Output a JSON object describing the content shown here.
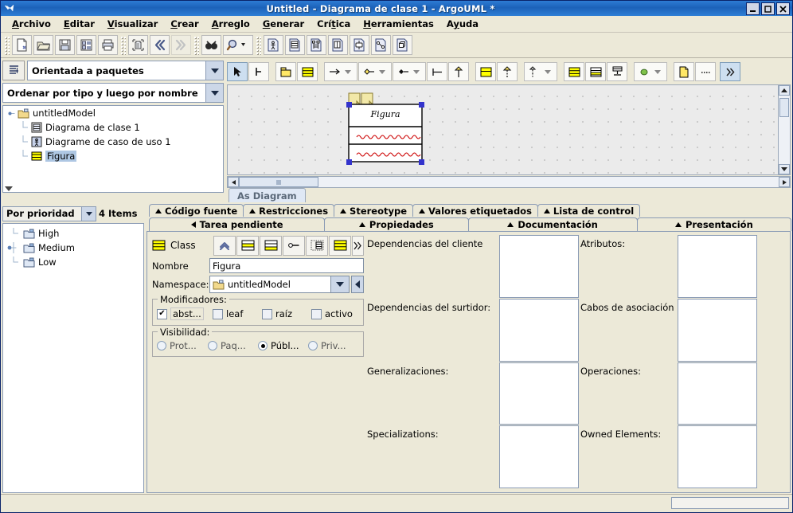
{
  "window": {
    "title": "Untitled - Diagrama de clase 1 - ArgoUML *",
    "app_icon": "argouml-icon",
    "buttons": {
      "minimize": "_",
      "maximize": "□",
      "close": "✕"
    }
  },
  "menubar": {
    "items": [
      {
        "label": "Archivo",
        "mnemonic": "A"
      },
      {
        "label": "Editar",
        "mnemonic": "E"
      },
      {
        "label": "Visualizar",
        "mnemonic": "V"
      },
      {
        "label": "Crear",
        "mnemonic": "C"
      },
      {
        "label": "Arreglo",
        "mnemonic": "A"
      },
      {
        "label": "Generar",
        "mnemonic": "G"
      },
      {
        "label": "Crítica",
        "mnemonic": "t"
      },
      {
        "label": "Herramientas",
        "mnemonic": "H"
      },
      {
        "label": "Ayuda",
        "mnemonic": "y"
      }
    ]
  },
  "main_toolbar": {
    "groups": [
      {
        "buttons": [
          {
            "name": "new-icon",
            "title": "Nuevo"
          },
          {
            "name": "open-icon",
            "title": "Abrir proyecto"
          },
          {
            "name": "save-icon",
            "title": "Guardar proyecto"
          },
          {
            "name": "properties-icon",
            "title": "Propiedades"
          },
          {
            "name": "print-icon",
            "title": "Imprimir"
          }
        ]
      },
      {
        "buttons": [
          {
            "name": "delete-icon",
            "title": "Borrar"
          },
          {
            "name": "navigate-back-icon",
            "title": "Atrás"
          },
          {
            "name": "navigate-forward-icon",
            "title": "Adelante",
            "disabled": true
          }
        ]
      },
      {
        "buttons": [
          {
            "name": "find-icon",
            "title": "Buscar"
          },
          {
            "name": "zoom-icon",
            "title": "Zoom",
            "has_dropdown": true
          }
        ]
      },
      {
        "buttons": [
          {
            "name": "new-usecase-diagram-icon",
            "title": "Nuevo diagrama de caso de uso"
          },
          {
            "name": "new-class-diagram-icon",
            "title": "Nuevo diagrama de clase"
          },
          {
            "name": "new-sequence-diagram-icon",
            "title": "Nuevo diagrama de secuencia"
          },
          {
            "name": "new-collaboration-diagram-icon",
            "title": "Nuevo diagrama de colaboración"
          },
          {
            "name": "new-state-diagram-icon",
            "title": "Nuevo diagrama de estado"
          },
          {
            "name": "new-activity-diagram-icon",
            "title": "Nuevo diagrama de actividad"
          },
          {
            "name": "new-deployment-diagram-icon",
            "title": "Nuevo diagrama de despliegue"
          }
        ]
      }
    ]
  },
  "explorer": {
    "perspective_button_icon": "perspective-icon",
    "perspective_combo": "Orientada a paquetes",
    "order_combo": "Ordenar por tipo y luego por nombre",
    "tree": [
      {
        "label": "untitledModel",
        "icon": "package-icon",
        "depth": 0,
        "expanded": true,
        "selected": false
      },
      {
        "label": "Diagrama de clase 1",
        "icon": "class-diagram-icon",
        "depth": 1,
        "selected": false
      },
      {
        "label": "Diagrame de caso de uso 1",
        "icon": "usecase-diagram-icon",
        "depth": 1,
        "selected": false
      },
      {
        "label": "Figura",
        "icon": "class-icon",
        "depth": 1,
        "selected": true
      }
    ]
  },
  "diagram": {
    "toolbar": [
      {
        "name": "select-tool-icon",
        "selected": true
      },
      {
        "name": "broom-tool-icon"
      },
      {
        "name": "package-tool-icon"
      },
      {
        "name": "class-tool-icon"
      },
      {
        "name": "association-tool-icon",
        "has_dropdown": true
      },
      {
        "name": "aggregation-tool-icon",
        "has_dropdown": true
      },
      {
        "name": "composition-tool-icon",
        "has_dropdown": true
      },
      {
        "name": "dependency-tool-icon"
      },
      {
        "name": "generalization-tool-icon"
      },
      {
        "name": "interface-tool-icon"
      },
      {
        "name": "realization-tool-icon"
      },
      {
        "name": "abstraction-tool-icon",
        "has_dropdown": true
      },
      {
        "name": "datatype-tool-icon"
      },
      {
        "name": "enumeration-tool-icon"
      },
      {
        "name": "stereotype-tool-icon"
      },
      {
        "name": "state-tool-icon",
        "has_dropdown": true
      },
      {
        "name": "comment-tool-icon"
      },
      {
        "name": "comment-link-tool-icon"
      },
      {
        "name": "more-tools-icon"
      }
    ],
    "class_figure": {
      "name": "Figura",
      "selected": true,
      "compartments": 2
    },
    "view_tab": "As Diagram"
  },
  "todo": {
    "combo": "Por prioridad",
    "items_count": "4 Items",
    "tree": [
      {
        "label": "High",
        "icon": "folder-icon",
        "expanded": false
      },
      {
        "label": "Medium",
        "icon": "folder-icon",
        "expanded": true
      },
      {
        "label": "Low",
        "icon": "folder-icon",
        "expanded": false
      }
    ]
  },
  "details": {
    "tabs_top": [
      {
        "label": "Código fuente",
        "marker": "up",
        "active": false
      },
      {
        "label": "Restricciones",
        "marker": "up",
        "active": false
      },
      {
        "label": "Stereotype",
        "marker": "up",
        "active": false
      },
      {
        "label": "Valores etiquetados",
        "marker": "up",
        "active": false
      },
      {
        "label": "Lista de control",
        "marker": "up",
        "active": false
      }
    ],
    "tabs_bottom": [
      {
        "label": "Tarea pendiente",
        "marker": "left",
        "active": false
      },
      {
        "label": "Propiedades",
        "marker": "up",
        "active": true
      },
      {
        "label": "Documentación",
        "marker": "up",
        "active": false
      },
      {
        "label": "Presentación",
        "marker": "up",
        "active": false
      }
    ],
    "properties": {
      "type_icon": "class-icon",
      "type_label": "Class",
      "toolbar": [
        {
          "name": "go-up-icon"
        },
        {
          "name": "new-attribute-icon"
        },
        {
          "name": "new-operation-icon"
        },
        {
          "name": "new-association-icon"
        },
        {
          "name": "new-inner-class-icon"
        },
        {
          "name": "new-class-icon"
        },
        {
          "name": "more-actions-icon"
        }
      ],
      "name_label": "Nombre",
      "name_value": "Figura",
      "namespace_label": "Namespace:",
      "namespace_value": "untitledModel",
      "namespace_icon": "package-icon",
      "modifiers_label": "Modificadores:",
      "modifiers": [
        {
          "label": "abst...",
          "checked": true
        },
        {
          "label": "leaf",
          "checked": false
        },
        {
          "label": "raíz",
          "checked": false
        },
        {
          "label": "activo",
          "checked": false
        }
      ],
      "visibility_label": "Visibilidad:",
      "visibility": [
        {
          "label": "Prot...",
          "selected": false
        },
        {
          "label": "Paq...",
          "selected": false
        },
        {
          "label": "Públ...",
          "selected": true
        },
        {
          "label": "Priv...",
          "selected": false
        }
      ],
      "lists": [
        {
          "label": "Dependencias del cliente",
          "value": ""
        },
        {
          "label": "Atributos:",
          "value": ""
        },
        {
          "label": "Dependencias del surtidor:",
          "value": ""
        },
        {
          "label": "Cabos de asociación",
          "value": ""
        },
        {
          "label": "Generalizaciones:",
          "value": ""
        },
        {
          "label": "Operaciones:",
          "value": ""
        },
        {
          "label": "Specializations:",
          "value": ""
        },
        {
          "label": "Owned Elements:",
          "value": ""
        }
      ]
    }
  },
  "status_bar": {
    "message": ""
  },
  "colors": {
    "title_bar": "#1c62b9",
    "window_bg": "#ece9d8",
    "panel_border": "#8a9bb5",
    "active_tab": "#cfe0f4",
    "selection": "#aec7e3",
    "class_yellow": "#ffff00",
    "error_underline": "#cc0000",
    "handle_blue": "#3333cc"
  }
}
